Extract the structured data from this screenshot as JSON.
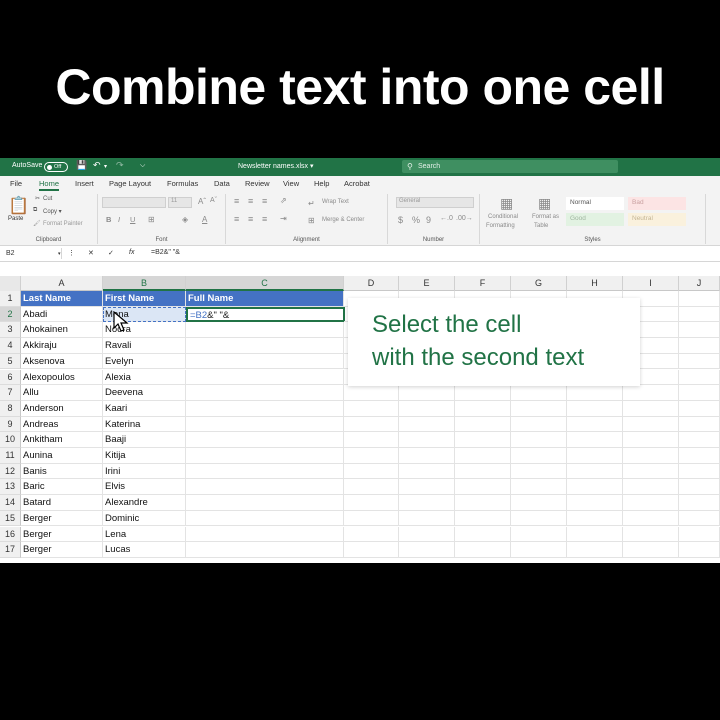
{
  "title": "Combine text into one cell",
  "app": {
    "autosave_label": "AutoSave",
    "autosave_state": "Off",
    "filename": "Newsletter names.xlsx ▾",
    "search_placeholder": "Search",
    "accent_color": "#217346",
    "header_fill": "#4472c4"
  },
  "menu": [
    "File",
    "Home",
    "Insert",
    "Page Layout",
    "Formulas",
    "Data",
    "Review",
    "View",
    "Help",
    "Acrobat"
  ],
  "ribbon": {
    "clipboard": {
      "paste": "Paste",
      "cut": "Cut",
      "copy": "Copy ▾",
      "format_painter": "Format Painter",
      "label": "Clipboard"
    },
    "font": {
      "size": "11",
      "label": "Font"
    },
    "alignment": {
      "wrap": "Wrap Text",
      "merge": "Merge & Center",
      "label": "Alignment"
    },
    "number": {
      "format": "General",
      "label": "Number"
    },
    "styles": {
      "conditional": "Conditional",
      "formatting": "Formatting",
      "format_as": "Format as",
      "table": "Table",
      "normal": "Normal",
      "bad": "Bad",
      "good": "Good",
      "neutral": "Neutral",
      "label": "Styles"
    }
  },
  "formula_bar": {
    "name_box": "B2",
    "fx": "fx",
    "formula": "=B2&\" \"&"
  },
  "columns": [
    "A",
    "B",
    "C",
    "D",
    "E",
    "F",
    "G",
    "H",
    "I",
    "J"
  ],
  "headers": [
    "Last Name",
    "First Name",
    "Full Name"
  ],
  "rows": [
    [
      "Abadi",
      "Mona"
    ],
    [
      "Ahokainen",
      "Noora"
    ],
    [
      "Akkiraju",
      "Ravali"
    ],
    [
      "Aksenova",
      "Evelyn"
    ],
    [
      "Alexopoulos",
      "Alexia"
    ],
    [
      "Allu",
      "Deevena"
    ],
    [
      "Anderson",
      "Kaari"
    ],
    [
      "Andreas",
      "Katerina"
    ],
    [
      "Ankitham",
      "Baaji"
    ],
    [
      "Aunina",
      "Kitija"
    ],
    [
      "Banis",
      "Irini"
    ],
    [
      "Baric",
      "Elvis"
    ],
    [
      "Batard",
      "Alexandre"
    ],
    [
      "Berger",
      "Dominic"
    ],
    [
      "Berger",
      "Lena"
    ],
    [
      "Berger",
      "Lucas"
    ]
  ],
  "active_cell": {
    "ref_part": "=B2",
    "rest": "&\" \"&"
  },
  "callout": {
    "line1": "Select the cell",
    "line2": "with the second text"
  }
}
